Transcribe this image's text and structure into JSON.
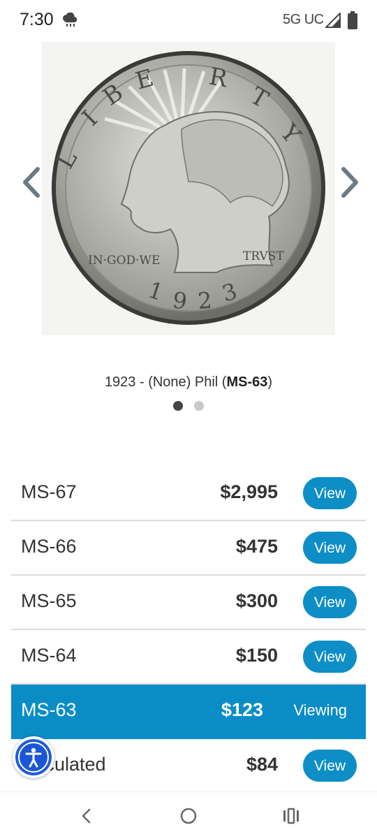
{
  "status_bar": {
    "time": "7:30",
    "network": "5G UC",
    "weather_icon": "cloud-rain-icon"
  },
  "carousel": {
    "coin_lettering": [
      "LIBERTY",
      "IN GOD WE",
      "TRUST",
      "1923"
    ],
    "caption_prefix": "1923 - (None) Phil (",
    "caption_grade": "MS-63",
    "caption_suffix": ")",
    "dots": 2,
    "active_dot": 0
  },
  "prices": [
    {
      "grade": "MS-67",
      "price": "$2,995",
      "action": "View"
    },
    {
      "grade": "MS-66",
      "price": "$475",
      "action": "View"
    },
    {
      "grade": "MS-65",
      "price": "$300",
      "action": "View"
    },
    {
      "grade": "MS-64",
      "price": "$150",
      "action": "View"
    },
    {
      "grade": "MS-63",
      "price": "$123",
      "action": "Viewing",
      "selected": true
    },
    {
      "grade": "Circulated",
      "price": "$84",
      "action": "View"
    }
  ],
  "colors": {
    "accent": "#0d8ec6",
    "accessibility": "#1e5bd8"
  }
}
